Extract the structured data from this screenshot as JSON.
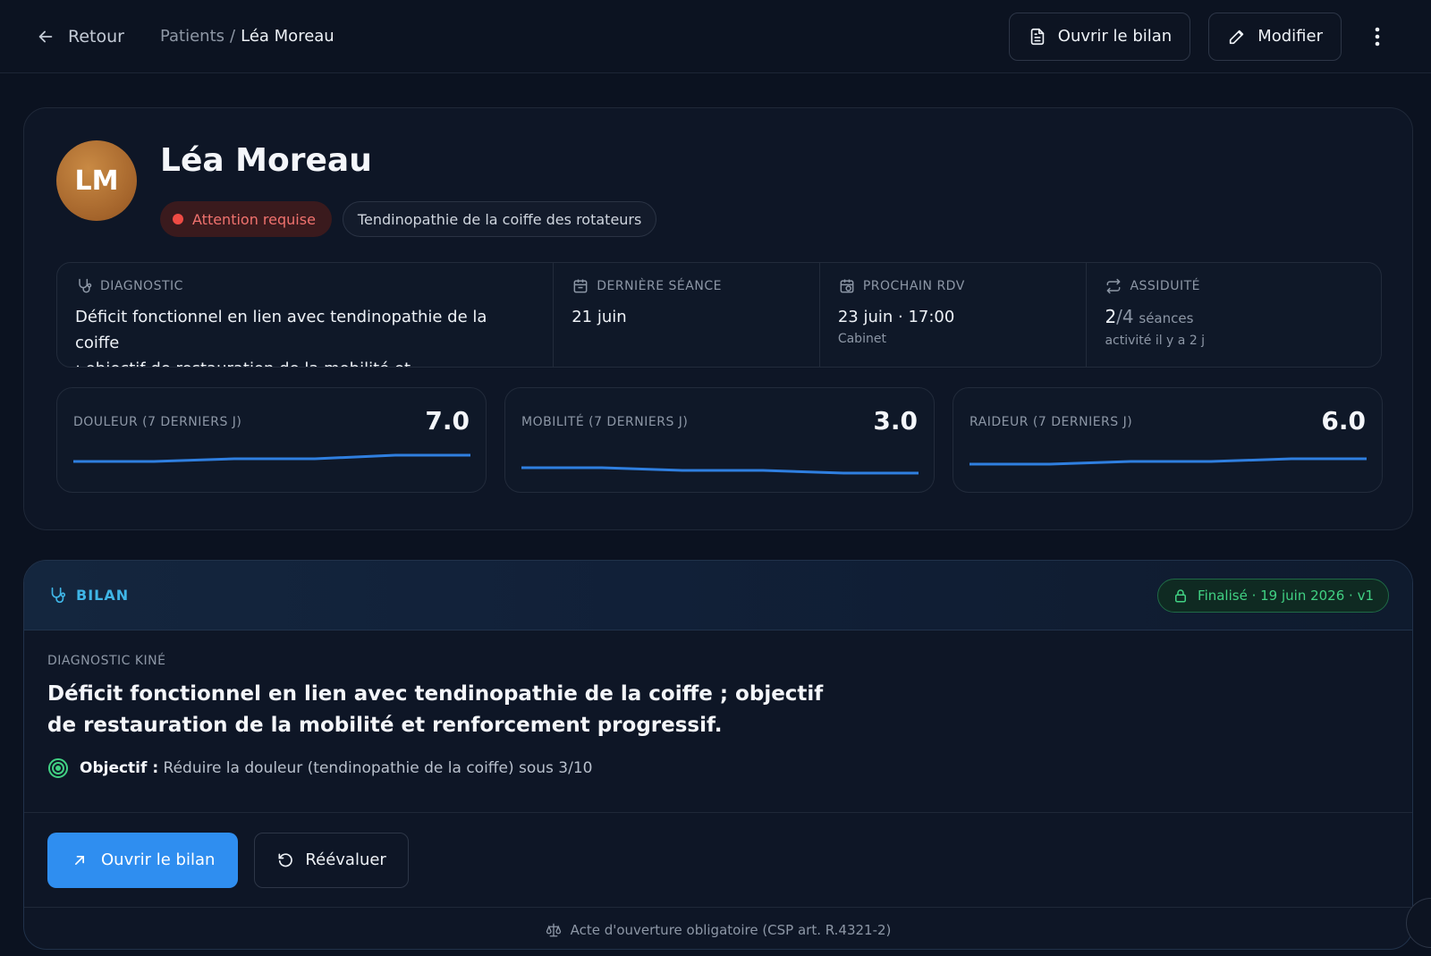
{
  "nav": {
    "back_label": "Retour",
    "breadcrumb_parent": "Patients",
    "breadcrumb_sep": "/",
    "breadcrumb_current": "Léa Moreau",
    "open_report_label": "Ouvrir le bilan",
    "edit_label": "Modifier"
  },
  "patient": {
    "initials": "LM",
    "name": "Léa Moreau",
    "alert_tag": "Attention requise",
    "condition_tag": "Tendinopathie de la coiffe des rotateurs",
    "alert_color": "#ef4b44",
    "avatar_color": "#a4642b"
  },
  "info": {
    "diagnostic": {
      "label": "DIAGNOSTIC",
      "value_line1": "Déficit fonctionnel en lien avec tendinopathie de la coiffe",
      "value_line2": "; objectif de restauration de la mobilité et renforcement..."
    },
    "last_session": {
      "label": "DERNIÈRE SÉANCE",
      "value": "21 juin"
    },
    "next_appt": {
      "label": "PROCHAIN RDV",
      "value": "23 juin · 17:00",
      "sub": "Cabinet"
    },
    "attendance": {
      "label": "ASSIDUITÉ",
      "done": "2",
      "total": "/4",
      "unit": "séances",
      "sub": "activité il y a 2 j"
    }
  },
  "metrics": [
    {
      "label": "DOULEUR (7 DERNIERS J)",
      "value": "7.0"
    },
    {
      "label": "MOBILITÉ (7 DERNIERS J)",
      "value": "3.0"
    },
    {
      "label": "RAIDEUR (7 DERNIERS J)",
      "value": "6.0"
    }
  ],
  "bilan": {
    "title": "BILAN",
    "status": "Finalisé · 19 juin 2026 · v1",
    "status_color": "#41d183",
    "diag_label": "DIAGNOSTIC KINÉ",
    "diag_text": "Déficit fonctionnel en lien avec tendinopathie de la coiffe ; objectif de restauration de la mobilité et renforcement progressif.",
    "objective_label": "Objectif :",
    "objective_text": "Réduire la douleur (tendinopathie de la coiffe) sous 3/10",
    "open_label": "Ouvrir le bilan",
    "reevaluate_label": "Réévaluer",
    "footnote": "Acte d'ouverture obligatoire (CSP art. R.4321-2)"
  },
  "accent": "#2f8ef0"
}
